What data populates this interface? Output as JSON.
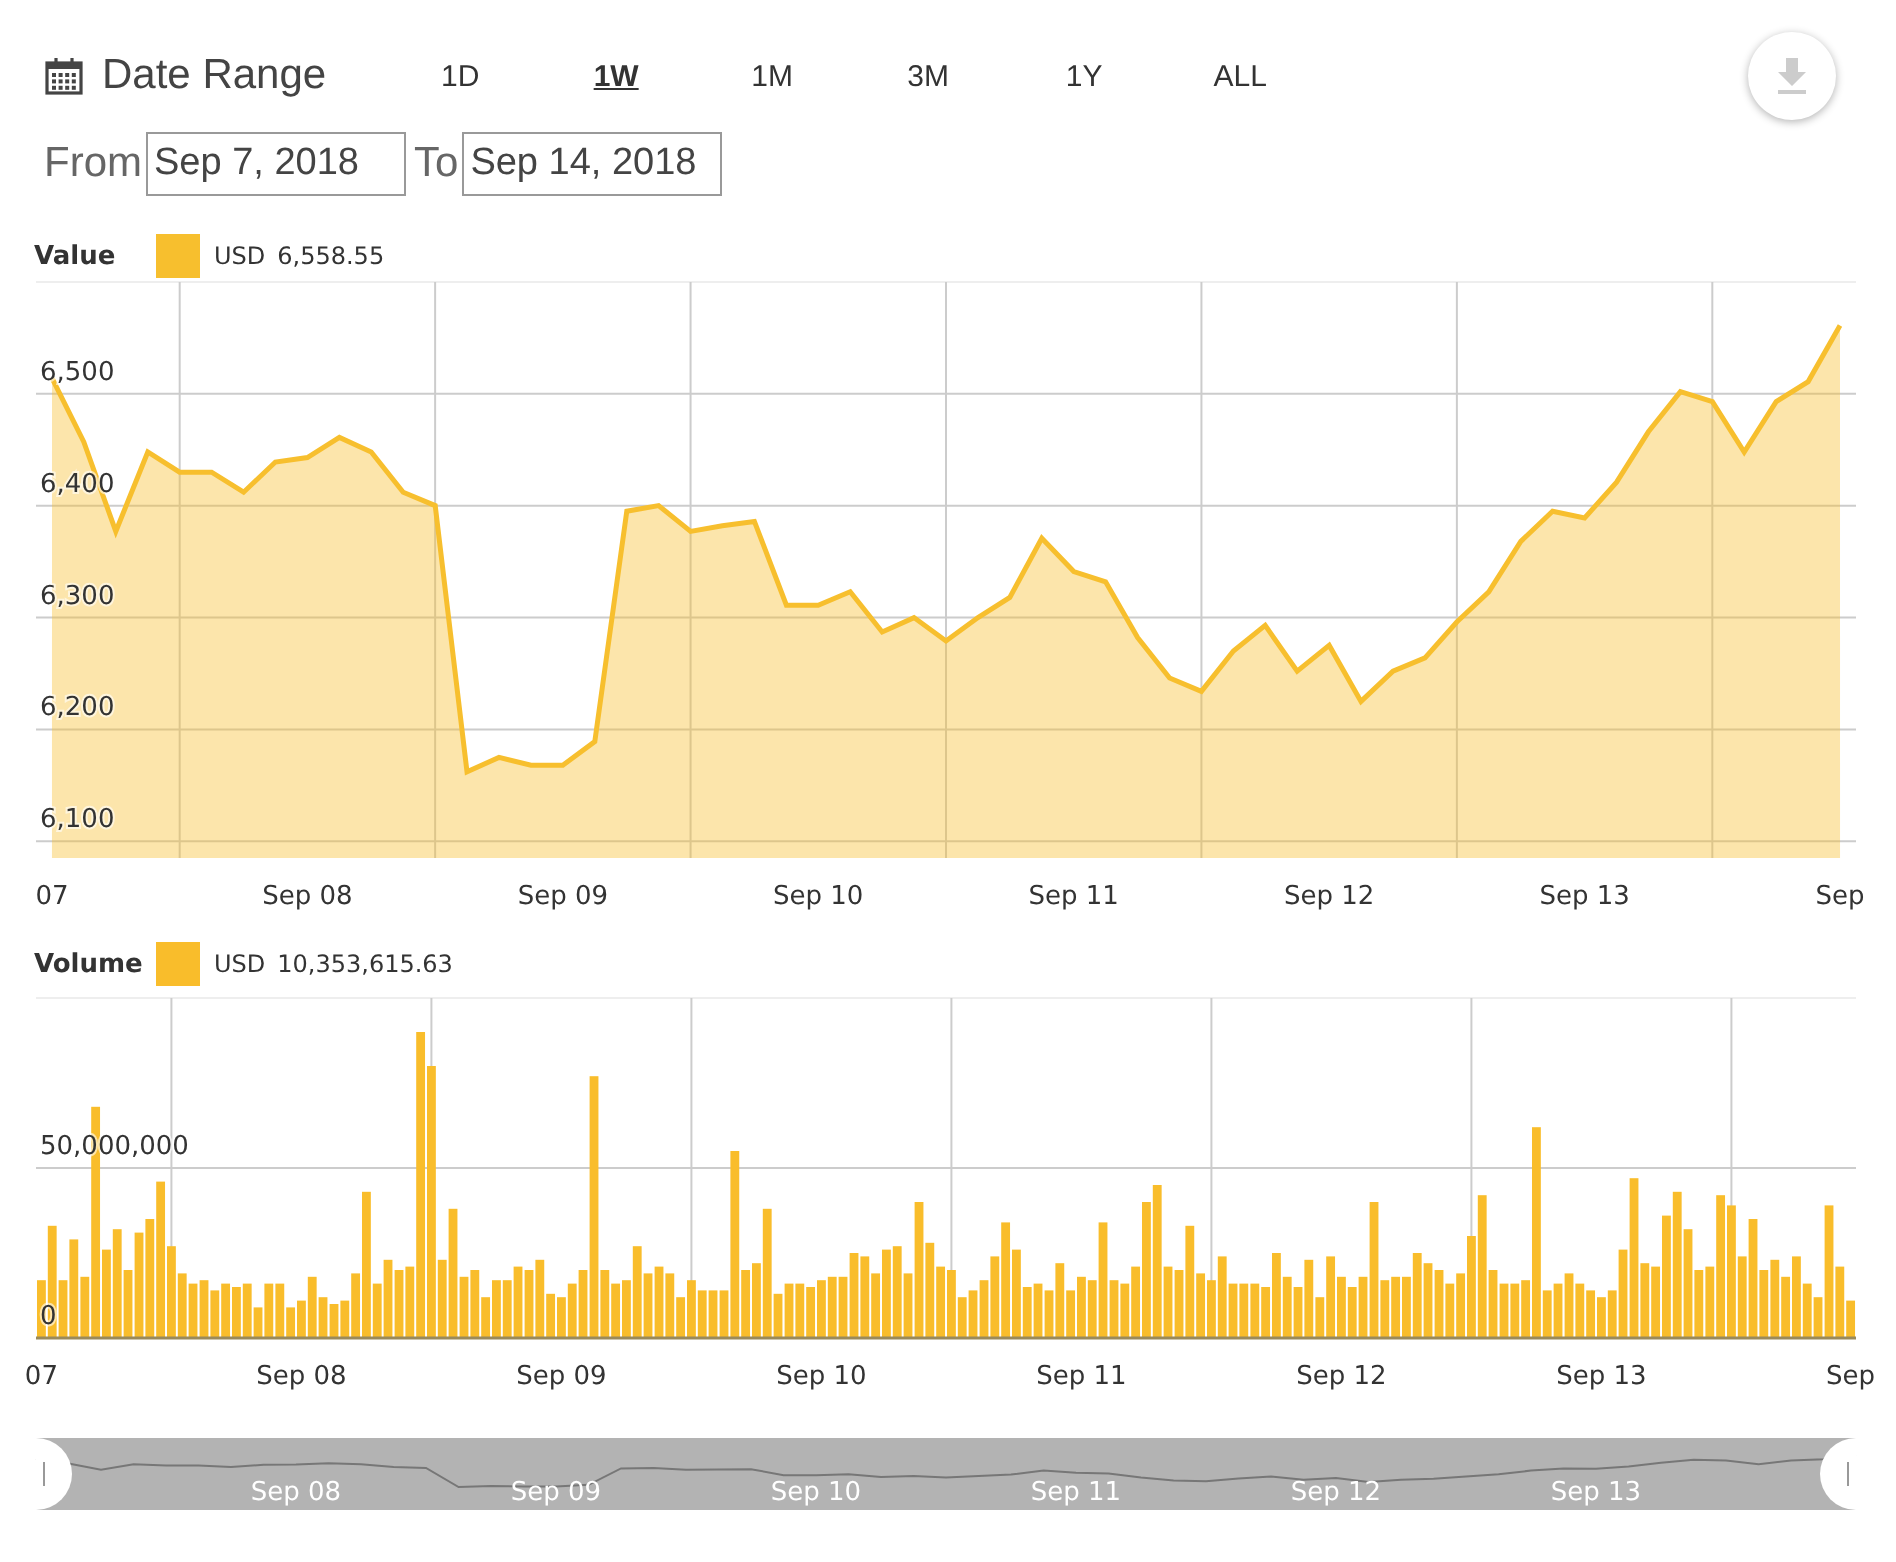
{
  "toolbar": {
    "title": "Date Range",
    "ranges": [
      {
        "label": "1D",
        "selected": false
      },
      {
        "label": "1W",
        "selected": true
      },
      {
        "label": "1M",
        "selected": false
      },
      {
        "label": "3M",
        "selected": false
      },
      {
        "label": "1Y",
        "selected": false
      },
      {
        "label": "ALL",
        "selected": false
      }
    ]
  },
  "date_inputs": {
    "from_label": "From",
    "from_value": "Sep 7, 2018",
    "to_label": "To",
    "to_value": "Sep 14, 2018"
  },
  "value_panel": {
    "title": "Value",
    "legend": {
      "amount": "6,558.55"
    },
    "chart_data": {
      "type": "area",
      "grid": true,
      "categories": [
        "07",
        null,
        null,
        null,
        null,
        null,
        null,
        null,
        "Sep 08",
        null,
        null,
        null,
        null,
        null,
        null,
        null,
        "Sep 09",
        null,
        null,
        null,
        null,
        null,
        null,
        null,
        "Sep 10",
        null,
        null,
        null,
        null,
        null,
        null,
        null,
        "Sep 11",
        null,
        null,
        null,
        null,
        null,
        null,
        null,
        "Sep 12",
        null,
        null,
        null,
        null,
        null,
        null,
        null,
        "Sep 13",
        null,
        null,
        null,
        null,
        null,
        null,
        null,
        "Sep"
      ],
      "series": [
        {
          "name": "USD",
          "color": "#f7bf2e",
          "values": [
            6514,
            6457,
            6377,
            6448,
            6430,
            6430,
            6412,
            6439,
            6443,
            6461,
            6448,
            6412,
            6400,
            6162,
            6175,
            6168,
            6168,
            6189,
            6395,
            6400,
            6377,
            6382,
            6386,
            6311,
            6311,
            6323,
            6287,
            6300,
            6279,
            6300,
            6318,
            6371,
            6341,
            6332,
            6282,
            6246,
            6234,
            6270,
            6293,
            6252,
            6275,
            6225,
            6252,
            6264,
            6296,
            6323,
            6368,
            6395,
            6389,
            6421,
            6466,
            6502,
            6493,
            6448,
            6493,
            6511,
            6561
          ]
        }
      ],
      "ylim": [
        6085,
        6600
      ],
      "yticks": [
        {
          "value": 6100,
          "label": "6,100"
        },
        {
          "value": 6200,
          "label": "6,200"
        },
        {
          "value": 6300,
          "label": "6,300"
        },
        {
          "value": 6400,
          "label": "6,400"
        },
        {
          "value": 6500,
          "label": "6,500"
        }
      ]
    }
  },
  "volume_panel": {
    "title": "Volume",
    "legend": {
      "amount": "10,353,615.63"
    },
    "chart_data": {
      "type": "bar",
      "grid": true,
      "categories": [
        "07",
        null,
        null,
        null,
        null,
        null,
        null,
        null,
        null,
        null,
        null,
        null,
        null,
        null,
        null,
        null,
        null,
        null,
        null,
        null,
        null,
        null,
        null,
        null,
        "Sep 08",
        null,
        null,
        null,
        null,
        null,
        null,
        null,
        null,
        null,
        null,
        null,
        null,
        null,
        null,
        null,
        null,
        null,
        null,
        null,
        null,
        null,
        null,
        null,
        "Sep 09",
        null,
        null,
        null,
        null,
        null,
        null,
        null,
        null,
        null,
        null,
        null,
        null,
        null,
        null,
        null,
        null,
        null,
        null,
        null,
        null,
        null,
        null,
        null,
        "Sep 10",
        null,
        null,
        null,
        null,
        null,
        null,
        null,
        null,
        null,
        null,
        null,
        null,
        null,
        null,
        null,
        null,
        null,
        null,
        null,
        null,
        null,
        null,
        null,
        "Sep 11",
        null,
        null,
        null,
        null,
        null,
        null,
        null,
        null,
        null,
        null,
        null,
        null,
        null,
        null,
        null,
        null,
        null,
        null,
        null,
        null,
        null,
        null,
        null,
        "Sep 12",
        null,
        null,
        null,
        null,
        null,
        null,
        null,
        null,
        null,
        null,
        null,
        null,
        null,
        null,
        null,
        null,
        null,
        null,
        null,
        null,
        null,
        null,
        null,
        "Sep 13",
        null,
        null,
        null,
        null,
        null,
        null,
        null,
        null,
        null,
        null,
        null,
        null,
        null,
        null,
        null,
        null,
        null,
        null,
        null,
        null,
        null,
        null,
        "Sep"
      ],
      "series": [
        {
          "name": "USD",
          "color": "#f9bd2b",
          "values": [
            17000000,
            33000000,
            17000000,
            29000000,
            18000000,
            68000000,
            26000000,
            32000000,
            20000000,
            31000000,
            35000000,
            46000000,
            27000000,
            19000000,
            16000000,
            17000000,
            14000000,
            16000000,
            15000000,
            16000000,
            9000000,
            16000000,
            16000000,
            9000000,
            11000000,
            18000000,
            12000000,
            10000000,
            11000000,
            19000000,
            43000000,
            16000000,
            23000000,
            20000000,
            21000000,
            90000000,
            80000000,
            23000000,
            38000000,
            18000000,
            20000000,
            12000000,
            17000000,
            17000000,
            21000000,
            20000000,
            23000000,
            13000000,
            12000000,
            16000000,
            20000000,
            77000000,
            20000000,
            16000000,
            17000000,
            27000000,
            19000000,
            21000000,
            19000000,
            12000000,
            17000000,
            14000000,
            14000000,
            14000000,
            55000000,
            20000000,
            22000000,
            38000000,
            13000000,
            16000000,
            16000000,
            15000000,
            17000000,
            18000000,
            18000000,
            25000000,
            24000000,
            19000000,
            26000000,
            27000000,
            19000000,
            40000000,
            28000000,
            21000000,
            20000000,
            12000000,
            14000000,
            17000000,
            24000000,
            34000000,
            26000000,
            15000000,
            16000000,
            14000000,
            22000000,
            14000000,
            18000000,
            17000000,
            34000000,
            17000000,
            16000000,
            21000000,
            40000000,
            45000000,
            21000000,
            20000000,
            33000000,
            19000000,
            17000000,
            24000000,
            16000000,
            16000000,
            16000000,
            15000000,
            25000000,
            18000000,
            15000000,
            23000000,
            12000000,
            24000000,
            18000000,
            15000000,
            18000000,
            40000000,
            17000000,
            18000000,
            18000000,
            25000000,
            22000000,
            20000000,
            16000000,
            19000000,
            30000000,
            42000000,
            20000000,
            16000000,
            16000000,
            17000000,
            62000000,
            14000000,
            16000000,
            19000000,
            16000000,
            14000000,
            12000000,
            14000000,
            26000000,
            47000000,
            22000000,
            21000000,
            36000000,
            43000000,
            32000000,
            20000000,
            21000000,
            42000000,
            39000000,
            24000000,
            35000000,
            20000000,
            23000000,
            18000000,
            24000000,
            16000000,
            12000000,
            39000000,
            21000000,
            11000000
          ]
        }
      ],
      "ylim": [
        0,
        100000000
      ],
      "yticks": [
        {
          "value": 0,
          "label": "0"
        },
        {
          "value": 50000000,
          "label": "50,000,000"
        }
      ]
    }
  },
  "navigator": {
    "labels": [
      "Sep 08",
      "Sep 09",
      "Sep 10",
      "Sep 11",
      "Sep 12",
      "Sep 13"
    ]
  }
}
